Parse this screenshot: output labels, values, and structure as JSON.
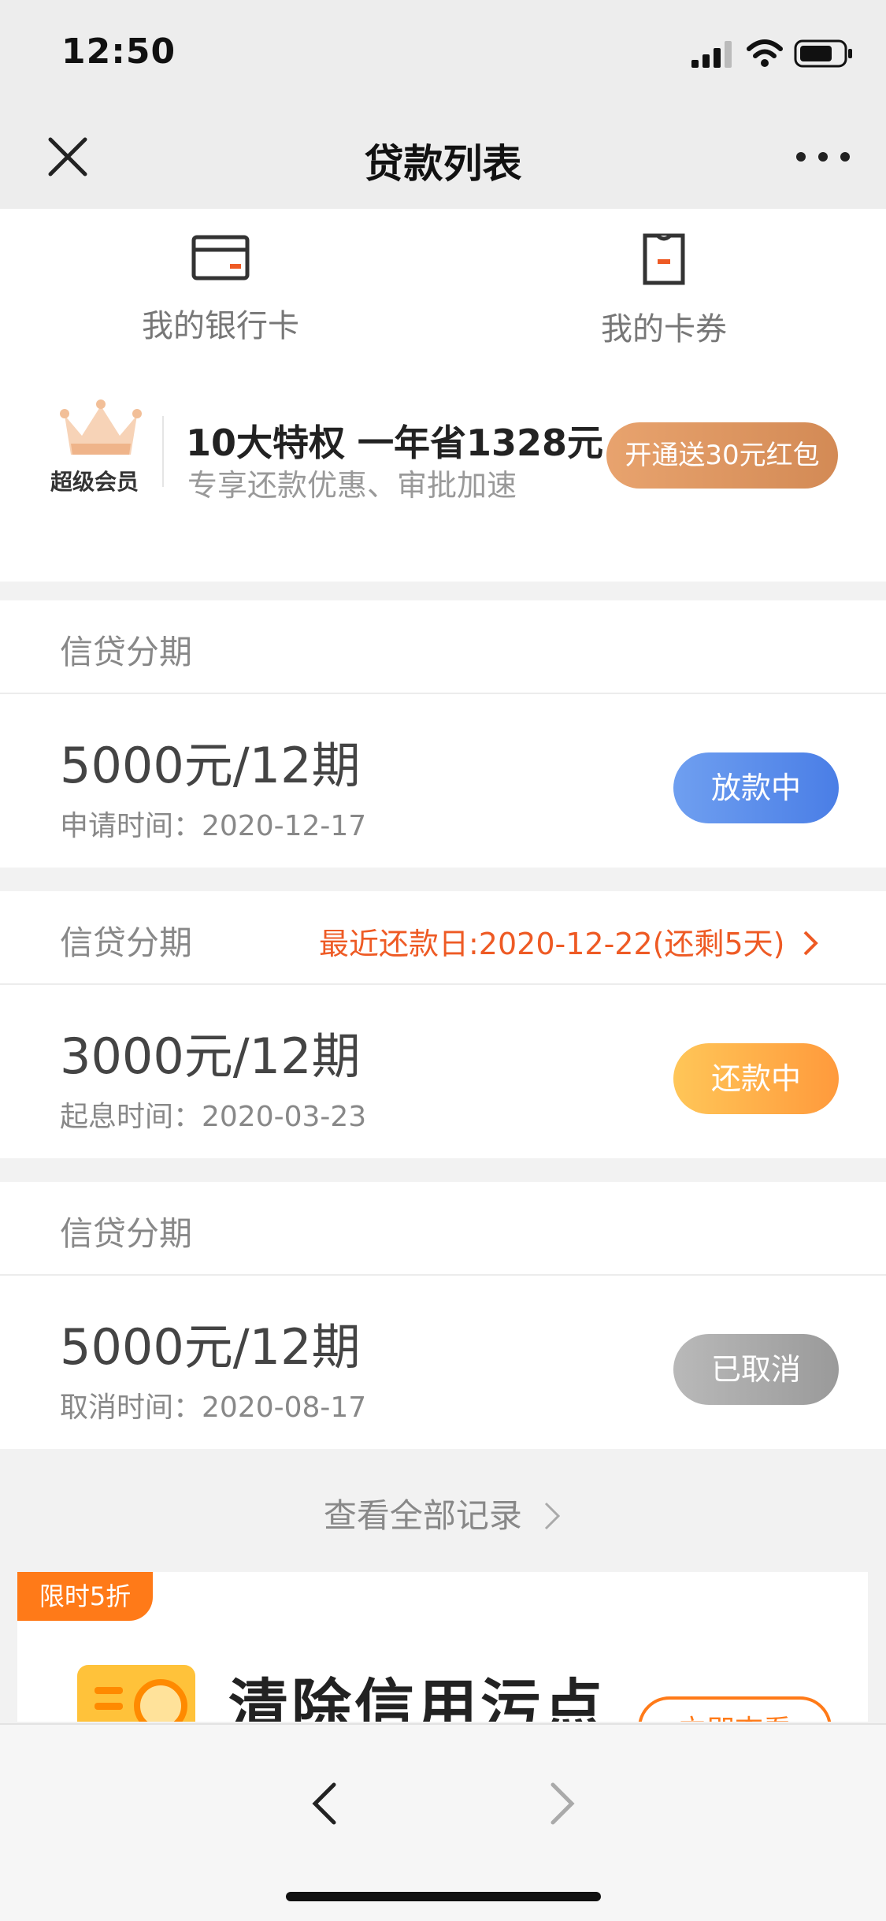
{
  "status_bar": {
    "time": "12:50"
  },
  "nav": {
    "title": "贷款列表"
  },
  "shortcuts": [
    {
      "label": "我的银行卡",
      "icon": "bank-card-icon"
    },
    {
      "label": "我的卡券",
      "icon": "coupon-icon"
    }
  ],
  "vip": {
    "label": "超级会员",
    "title": "10大特权 一年省1328元",
    "subtitle": "专享还款优惠、审批加速",
    "button": "开通送30元红包",
    "icon": "crown-icon"
  },
  "loans": [
    {
      "category": "信贷分期",
      "amount": "5000元/12期",
      "date_label": "申请时间：2020-12-17",
      "status": "放款中",
      "status_color": "#4a7ee6"
    },
    {
      "category": "信贷分期",
      "due_notice": "最近还款日:2020-12-22(还剩5天)",
      "amount": "3000元/12期",
      "date_label": "起息时间：2020-03-23",
      "status": "还款中",
      "status_color": "#ff9a3c"
    },
    {
      "category": "信贷分期",
      "amount": "5000元/12期",
      "date_label": "取消时间：2020-08-17",
      "status": "已取消",
      "status_color": "#9a9a9a"
    }
  ],
  "view_all": "查看全部记录",
  "promo": {
    "badge": "限时5折",
    "title": "清除信用污点",
    "button": "立即查看"
  },
  "colors": {
    "accent_orange": "#ee5a24",
    "vip_gold": "#d38a55"
  }
}
